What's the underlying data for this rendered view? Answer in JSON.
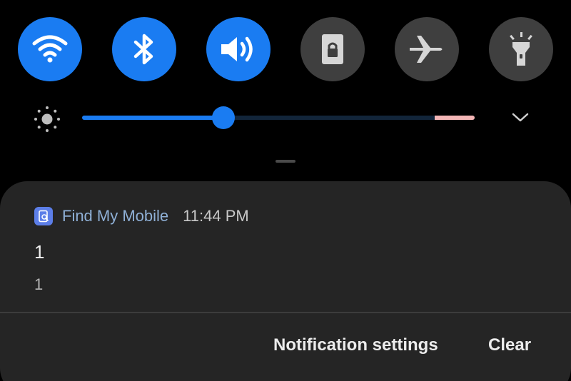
{
  "quick_settings": {
    "tiles": [
      {
        "id": "wifi",
        "icon": "wifi-icon",
        "state": "on"
      },
      {
        "id": "bluetooth",
        "icon": "bluetooth-icon",
        "state": "on"
      },
      {
        "id": "sound",
        "icon": "volume-icon",
        "state": "on"
      },
      {
        "id": "screen_lock",
        "icon": "lock-screen-icon",
        "state": "off"
      },
      {
        "id": "airplane_mode",
        "icon": "airplane-icon",
        "state": "off"
      },
      {
        "id": "flashlight",
        "icon": "flashlight-icon",
        "state": "off"
      }
    ],
    "colors": {
      "on": "#1a7cf2",
      "off": "#3f3f3f"
    }
  },
  "brightness": {
    "icon": "brightness-sun-icon",
    "level": 0.36,
    "outdoor_segment_color": "#f4b6b6",
    "expand_icon": "chevron-down-icon"
  },
  "notification": {
    "app_icon": "find-my-mobile-app-icon",
    "app_name": "Find My Mobile",
    "time": "11:44 PM",
    "title": "1",
    "text": "1",
    "actions": {
      "settings_label": "Notification settings",
      "clear_label": "Clear"
    }
  }
}
